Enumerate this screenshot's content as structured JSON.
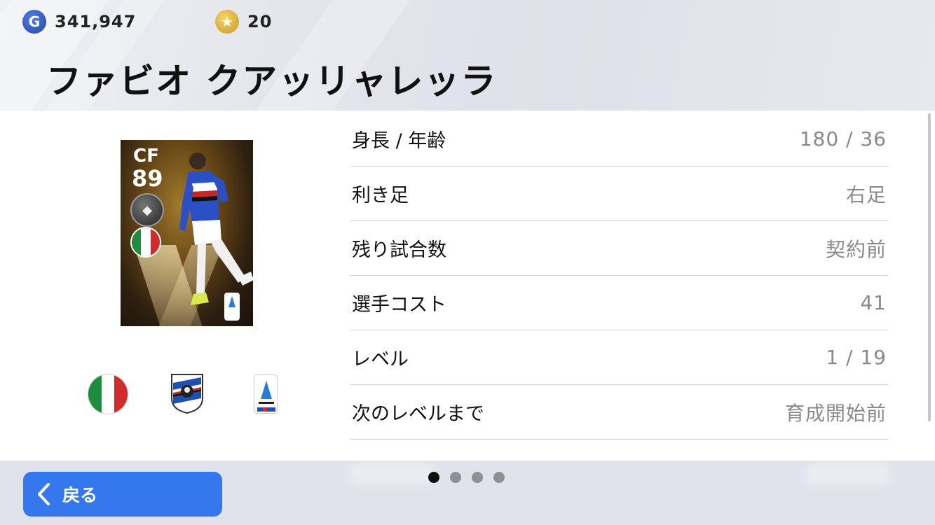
{
  "header": {
    "gp": {
      "icon": "g-coin-icon",
      "letter": "G",
      "value": "341,947"
    },
    "coins": {
      "icon": "star-coin-icon",
      "value": "20"
    },
    "player_name": "ファビオ クアッリャレッラ"
  },
  "card": {
    "position": "CF",
    "rating": "89",
    "badge_icon": "wolf-badge-icon",
    "nationality_flag": "italy-flag-icon",
    "league_icon": "serie-a-logo-icon"
  },
  "affiliations": {
    "nationality_icon": "italy-flag-icon",
    "club_icon": "sampdoria-crest-icon",
    "league_icon": "serie-a-logo-icon"
  },
  "stats": [
    {
      "label": "身長 / 年齢",
      "value": "180 / 36"
    },
    {
      "label": "利き足",
      "value": "右足"
    },
    {
      "label": "残り試合数",
      "value": "契約前"
    },
    {
      "label": "選手コスト",
      "value": "41"
    },
    {
      "label": "レベル",
      "value": "1 / 19"
    },
    {
      "label": "次のレベルまで",
      "value": "育成開始前"
    }
  ],
  "footer": {
    "back_label": "戻る",
    "back_icon": "chevron-left-icon",
    "pages": 4,
    "current_page": 1
  },
  "colors": {
    "accent": "#3577ec",
    "header_bg": "#e1e3ea",
    "value_text": "#8a8a8a"
  }
}
